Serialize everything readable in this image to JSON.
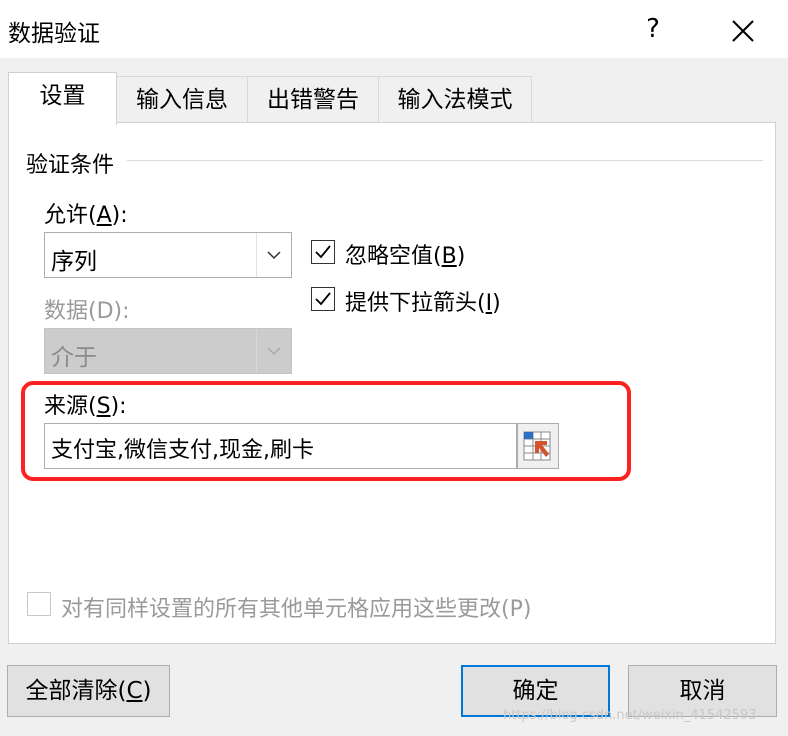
{
  "window": {
    "title": "数据验证",
    "help_label": "?",
    "close_icon": "close-icon"
  },
  "tabs": [
    {
      "label": "设置",
      "active": true
    },
    {
      "label": "输入信息",
      "active": false
    },
    {
      "label": "出错警告",
      "active": false
    },
    {
      "label": "输入法模式",
      "active": false
    }
  ],
  "criteria": {
    "group_label": "验证条件",
    "allow": {
      "label_prefix": "允许(",
      "accel": "A",
      "label_suffix": "):",
      "value": "序列"
    },
    "data": {
      "label": "数据(D):",
      "value": "介于",
      "enabled": false
    },
    "ignore_blank": {
      "label_prefix": "忽略空值(",
      "accel": "B",
      "label_suffix": ")",
      "checked": true
    },
    "in_cell_dropdown": {
      "label_prefix": "提供下拉箭头(",
      "accel": "I",
      "label_suffix": ")",
      "checked": true
    },
    "source": {
      "label_prefix": "来源(",
      "accel": "S",
      "label_suffix": "):",
      "value": "支付宝,微信支付,现金,刷卡",
      "highlight_color": "#ff2020"
    }
  },
  "apply_all": {
    "label": "对有同样设置的所有其他单元格应用这些更改(P)",
    "checked": false,
    "enabled": false
  },
  "buttons": {
    "clear_prefix": "全部清除(",
    "clear_accel": "C",
    "clear_suffix": ")",
    "ok": "确定",
    "cancel": "取消"
  },
  "watermark": "https://blog.csdn.net/weixin_41542593",
  "colors": {
    "accent": "#0078d7",
    "dialog_bg": "#f0f0f0",
    "highlight": "#ff2020"
  }
}
